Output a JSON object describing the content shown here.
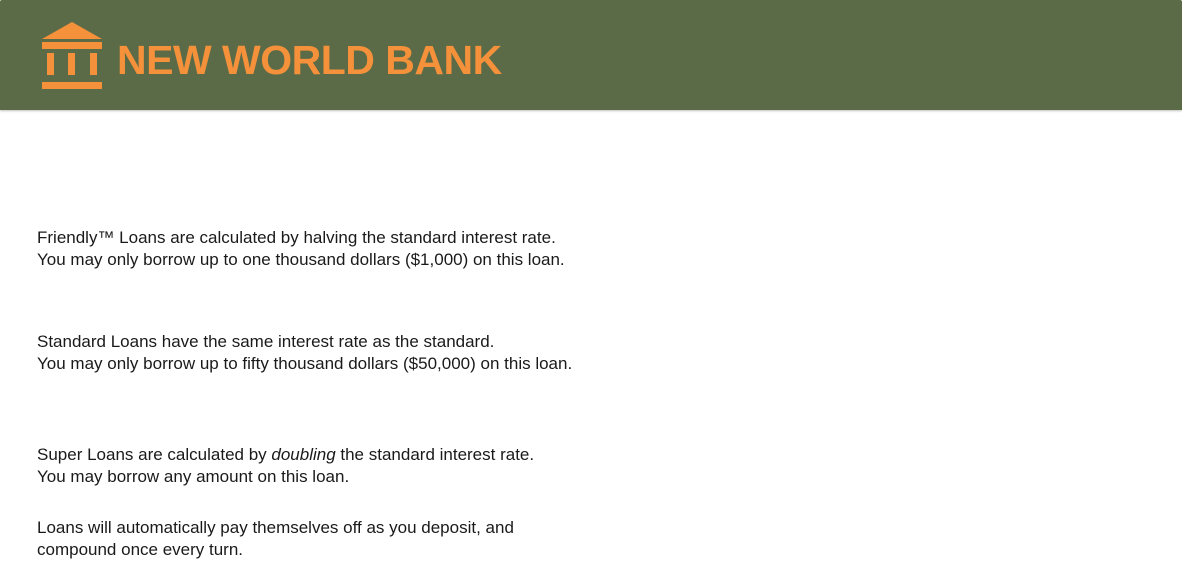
{
  "header": {
    "brand_name": "NEW WORLD BANK",
    "logo_icon": "bank-building-icon",
    "background_color": "#5b6b47",
    "brand_color": "#f4913a"
  },
  "loan_info": {
    "friendly": {
      "line1": "Friendly™ Loans are calculated by halving the standard interest rate.",
      "line2": "You may only borrow up to one thousand dollars ($1,000) on this loan."
    },
    "standard": {
      "line1": "Standard Loans have the same interest rate as the standard.",
      "line2": "You may only borrow up to fifty thousand dollars ($50,000) on this loan."
    },
    "super": {
      "line1_before": "Super Loans are calculated by ",
      "line1_emphasis": "doubling",
      "line1_after": " the standard interest rate.",
      "line2": "You may borrow any amount on this loan."
    },
    "repayment": {
      "line1": "Loans will automatically pay themselves off as you deposit, and",
      "line2": "compound once every turn."
    }
  }
}
